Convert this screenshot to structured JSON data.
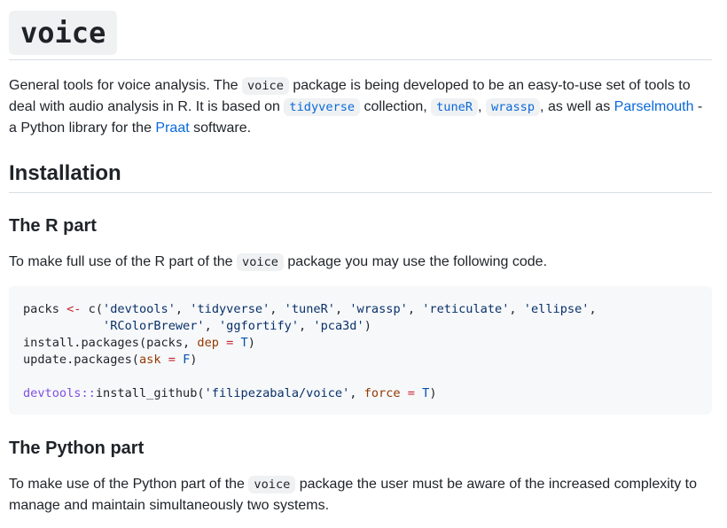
{
  "title": "voice",
  "intro": {
    "t1": "General tools for voice analysis. The ",
    "code1": "voice",
    "t2": " package is being developed to be an easy-to-use set of tools to deal with audio analysis in R. It is based on ",
    "link_tidyverse": "tidyverse",
    "t3": " collection, ",
    "link_tuner": "tuneR",
    "t4": ", ",
    "link_wrassp": "wrassp",
    "t5": ", as well as ",
    "link_parselmouth": "Parselmouth",
    "t6": " - a Python library for the ",
    "link_praat": "Praat",
    "t7": " software."
  },
  "installation": {
    "heading": "Installation"
  },
  "r_part": {
    "heading": "The R part",
    "t1": "To make full use of the R part of the ",
    "code": "voice",
    "t2": " package you may use the following code."
  },
  "code": {
    "l1_var": "packs ",
    "l1_assign": "<-",
    "l1_call": " c(",
    "s1": "'devtools'",
    "s2": "'tidyverse'",
    "s3": "'tuneR'",
    "s4": "'wrassp'",
    "s5": "'reticulate'",
    "s6": "'ellipse'",
    "comma": ", ",
    "comma_end": ",",
    "l2_indent": "           ",
    "s7": "'RColorBrewer'",
    "s8": "'ggfortify'",
    "s9": "'pca3d'",
    "close": ")",
    "l3_fn": "install.packages(packs, ",
    "l3_arg": "dep",
    "eq": " = ",
    "l3_val": "T",
    "l4_fn": "update.packages(",
    "l4_arg": "ask",
    "l4_val": "F",
    "l6_ns": "devtools::",
    "l6_fn": "install_github(",
    "s10": "'filipezabala/voice'",
    "l6_arg": "force",
    "l6_val": "T"
  },
  "python_part": {
    "heading": "The Python part",
    "t1": "To make use of the Python part of the ",
    "code": "voice",
    "t2": " package the user must be aware of the increased complexity to manage and maintain simultaneously two systems."
  }
}
